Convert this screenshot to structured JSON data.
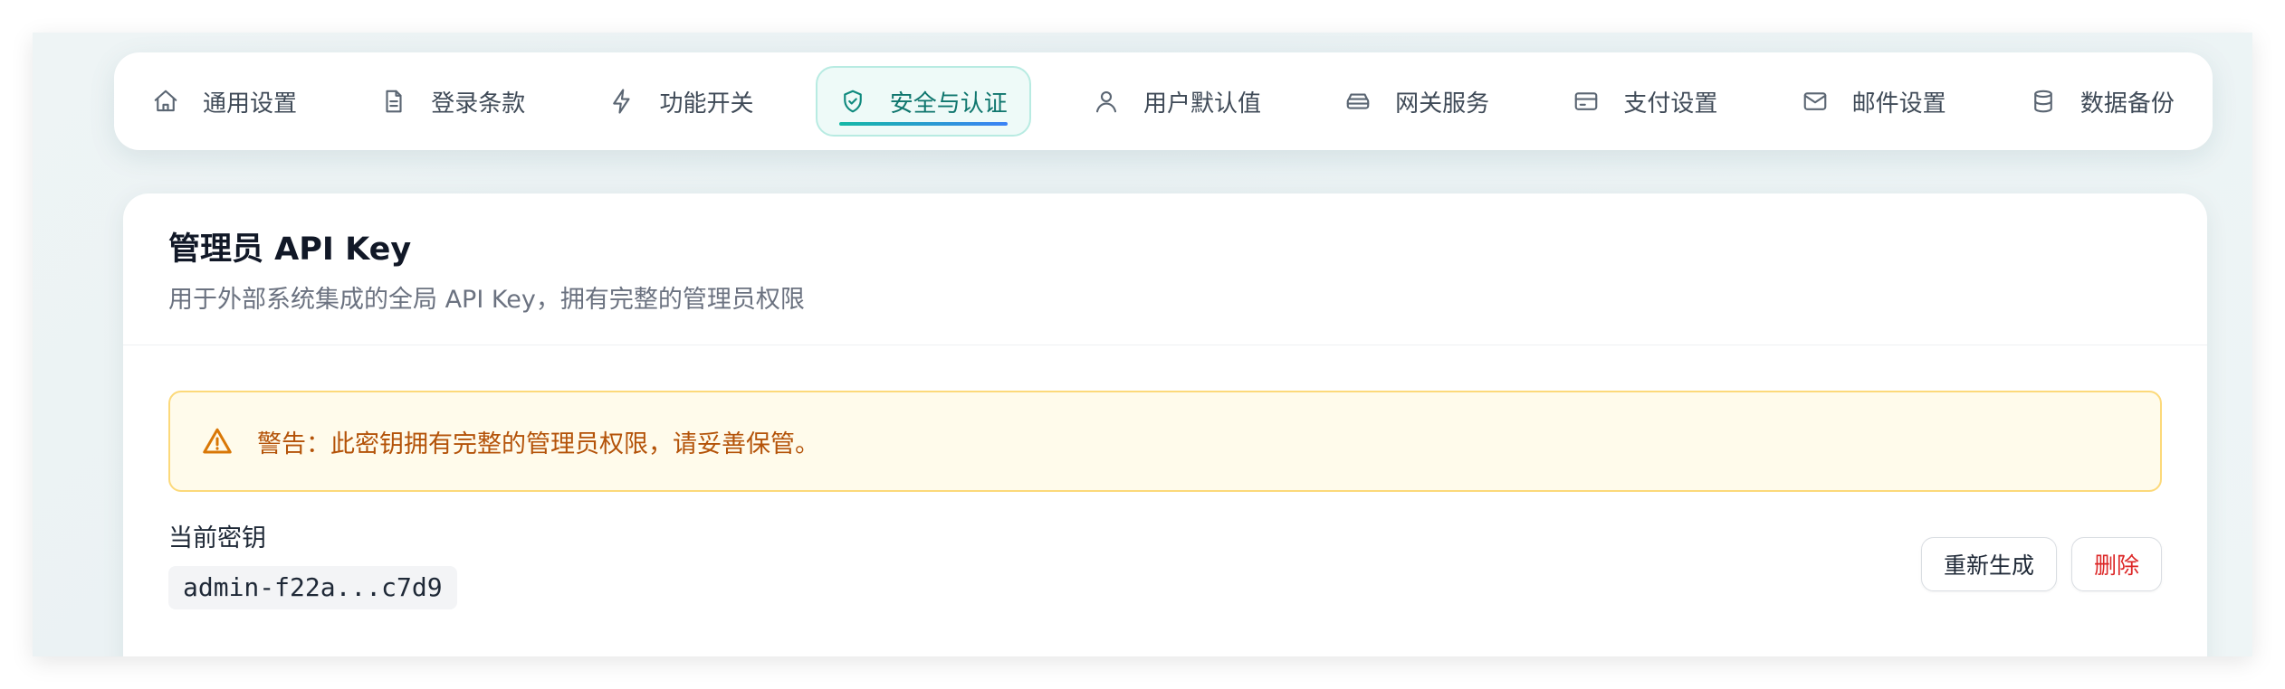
{
  "tabs": [
    {
      "label": "通用设置",
      "icon": "home-icon"
    },
    {
      "label": "登录条款",
      "icon": "document-icon"
    },
    {
      "label": "功能开关",
      "icon": "lightning-icon"
    },
    {
      "label": "安全与认证",
      "icon": "shield-check-icon",
      "active": true
    },
    {
      "label": "用户默认值",
      "icon": "user-icon"
    },
    {
      "label": "网关服务",
      "icon": "server-icon"
    },
    {
      "label": "支付设置",
      "icon": "credit-card-icon"
    },
    {
      "label": "邮件设置",
      "icon": "mail-icon"
    },
    {
      "label": "数据备份",
      "icon": "database-icon"
    }
  ],
  "card": {
    "title": "管理员 API Key",
    "description": "用于外部系统集成的全局 API Key，拥有完整的管理员权限",
    "warning": "警告：此密钥拥有完整的管理员权限，请妥善保管。",
    "key_label": "当前密钥",
    "key_value": "admin-f22a...c7d9",
    "regenerate_label": "重新生成",
    "delete_label": "删除"
  },
  "colors": {
    "accent": "#0f766e",
    "warning_text": "#b45309",
    "danger": "#dc2626"
  }
}
